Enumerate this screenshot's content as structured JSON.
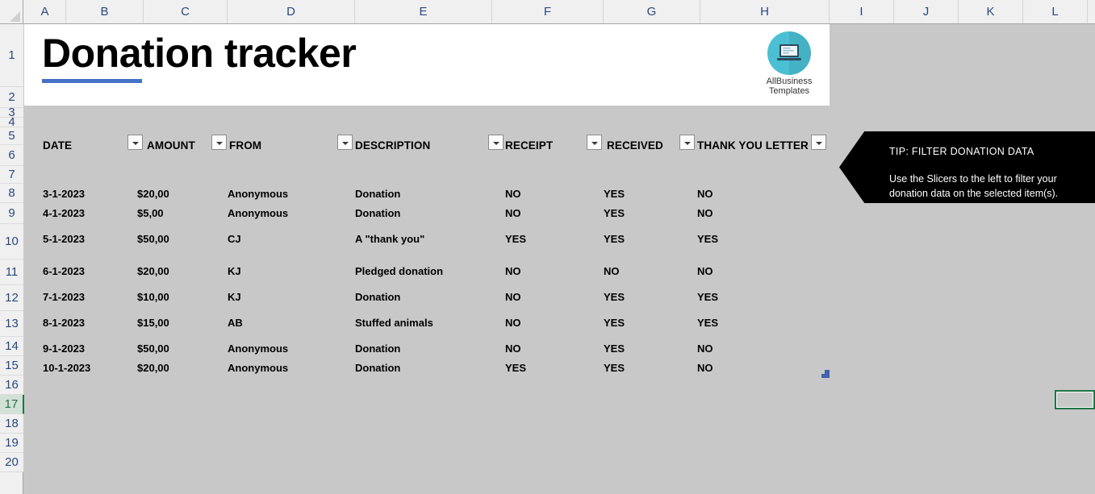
{
  "app": {
    "columns": [
      "A",
      "B",
      "C",
      "D",
      "E",
      "F",
      "G",
      "H",
      "I",
      "J",
      "K",
      "L"
    ],
    "rows": [
      "1",
      "2",
      "3",
      "4",
      "5",
      "6",
      "7",
      "8",
      "9",
      "10",
      "11",
      "12",
      "13",
      "14",
      "15",
      "16",
      "17",
      "18",
      "19",
      "20"
    ],
    "active_row": "17",
    "select_all_icon": "select-all-triangle-icon"
  },
  "header": {
    "title": "Donation tracker",
    "accent_color": "#4472c4",
    "logo": {
      "line1": "AllBusiness",
      "line2": "Templates",
      "icon": "laptop-icon",
      "circle_color": "#4bbfd3"
    }
  },
  "table": {
    "columns": [
      {
        "label": "DATE",
        "filter_icon": "filter-dropdown-icon"
      },
      {
        "label": "AMOUNT",
        "filter_icon": "filter-dropdown-icon"
      },
      {
        "label": "FROM",
        "filter_icon": "filter-dropdown-icon"
      },
      {
        "label": "DESCRIPTION",
        "filter_icon": "filter-dropdown-icon"
      },
      {
        "label": "RECEIPT",
        "filter_icon": "filter-dropdown-icon"
      },
      {
        "label": "RECEIVED",
        "filter_icon": "filter-dropdown-icon"
      },
      {
        "label": "THANK YOU LETTER",
        "filter_icon": "filter-dropdown-icon"
      }
    ],
    "rows": [
      {
        "date": "3-1-2023",
        "amount": "$20,00",
        "from": "Anonymous",
        "description": "Donation",
        "receipt": "NO",
        "received": "YES",
        "thank_you": "NO"
      },
      {
        "date": "4-1-2023",
        "amount": "$5,00",
        "from": "Anonymous",
        "description": "Donation",
        "receipt": "NO",
        "received": "YES",
        "thank_you": "NO"
      },
      {
        "date": "5-1-2023",
        "amount": "$50,00",
        "from": "CJ",
        "description": "A \"thank you\"",
        "receipt": "YES",
        "received": "YES",
        "thank_you": "YES"
      },
      {
        "date": "6-1-2023",
        "amount": "$20,00",
        "from": "KJ",
        "description": "Pledged donation",
        "receipt": "NO",
        "received": "NO",
        "thank_you": "NO"
      },
      {
        "date": "7-1-2023",
        "amount": "$10,00",
        "from": "KJ",
        "description": "Donation",
        "receipt": "NO",
        "received": "YES",
        "thank_you": "YES"
      },
      {
        "date": "8-1-2023",
        "amount": "$15,00",
        "from": "AB",
        "description": "Stuffed animals",
        "receipt": "NO",
        "received": "YES",
        "thank_you": "YES"
      },
      {
        "date": "9-1-2023",
        "amount": "$50,00",
        "from": "Anonymous",
        "description": "Donation",
        "receipt": "NO",
        "received": "YES",
        "thank_you": "NO"
      },
      {
        "date": "10-1-2023",
        "amount": "$20,00",
        "from": "Anonymous",
        "description": "Donation",
        "receipt": "YES",
        "received": "YES",
        "thank_you": "NO"
      }
    ]
  },
  "callout": {
    "title": "TIP: FILTER DONATION DATA",
    "body": "Use the Slicers to the left to filter your donation data on the selected item(s)."
  }
}
